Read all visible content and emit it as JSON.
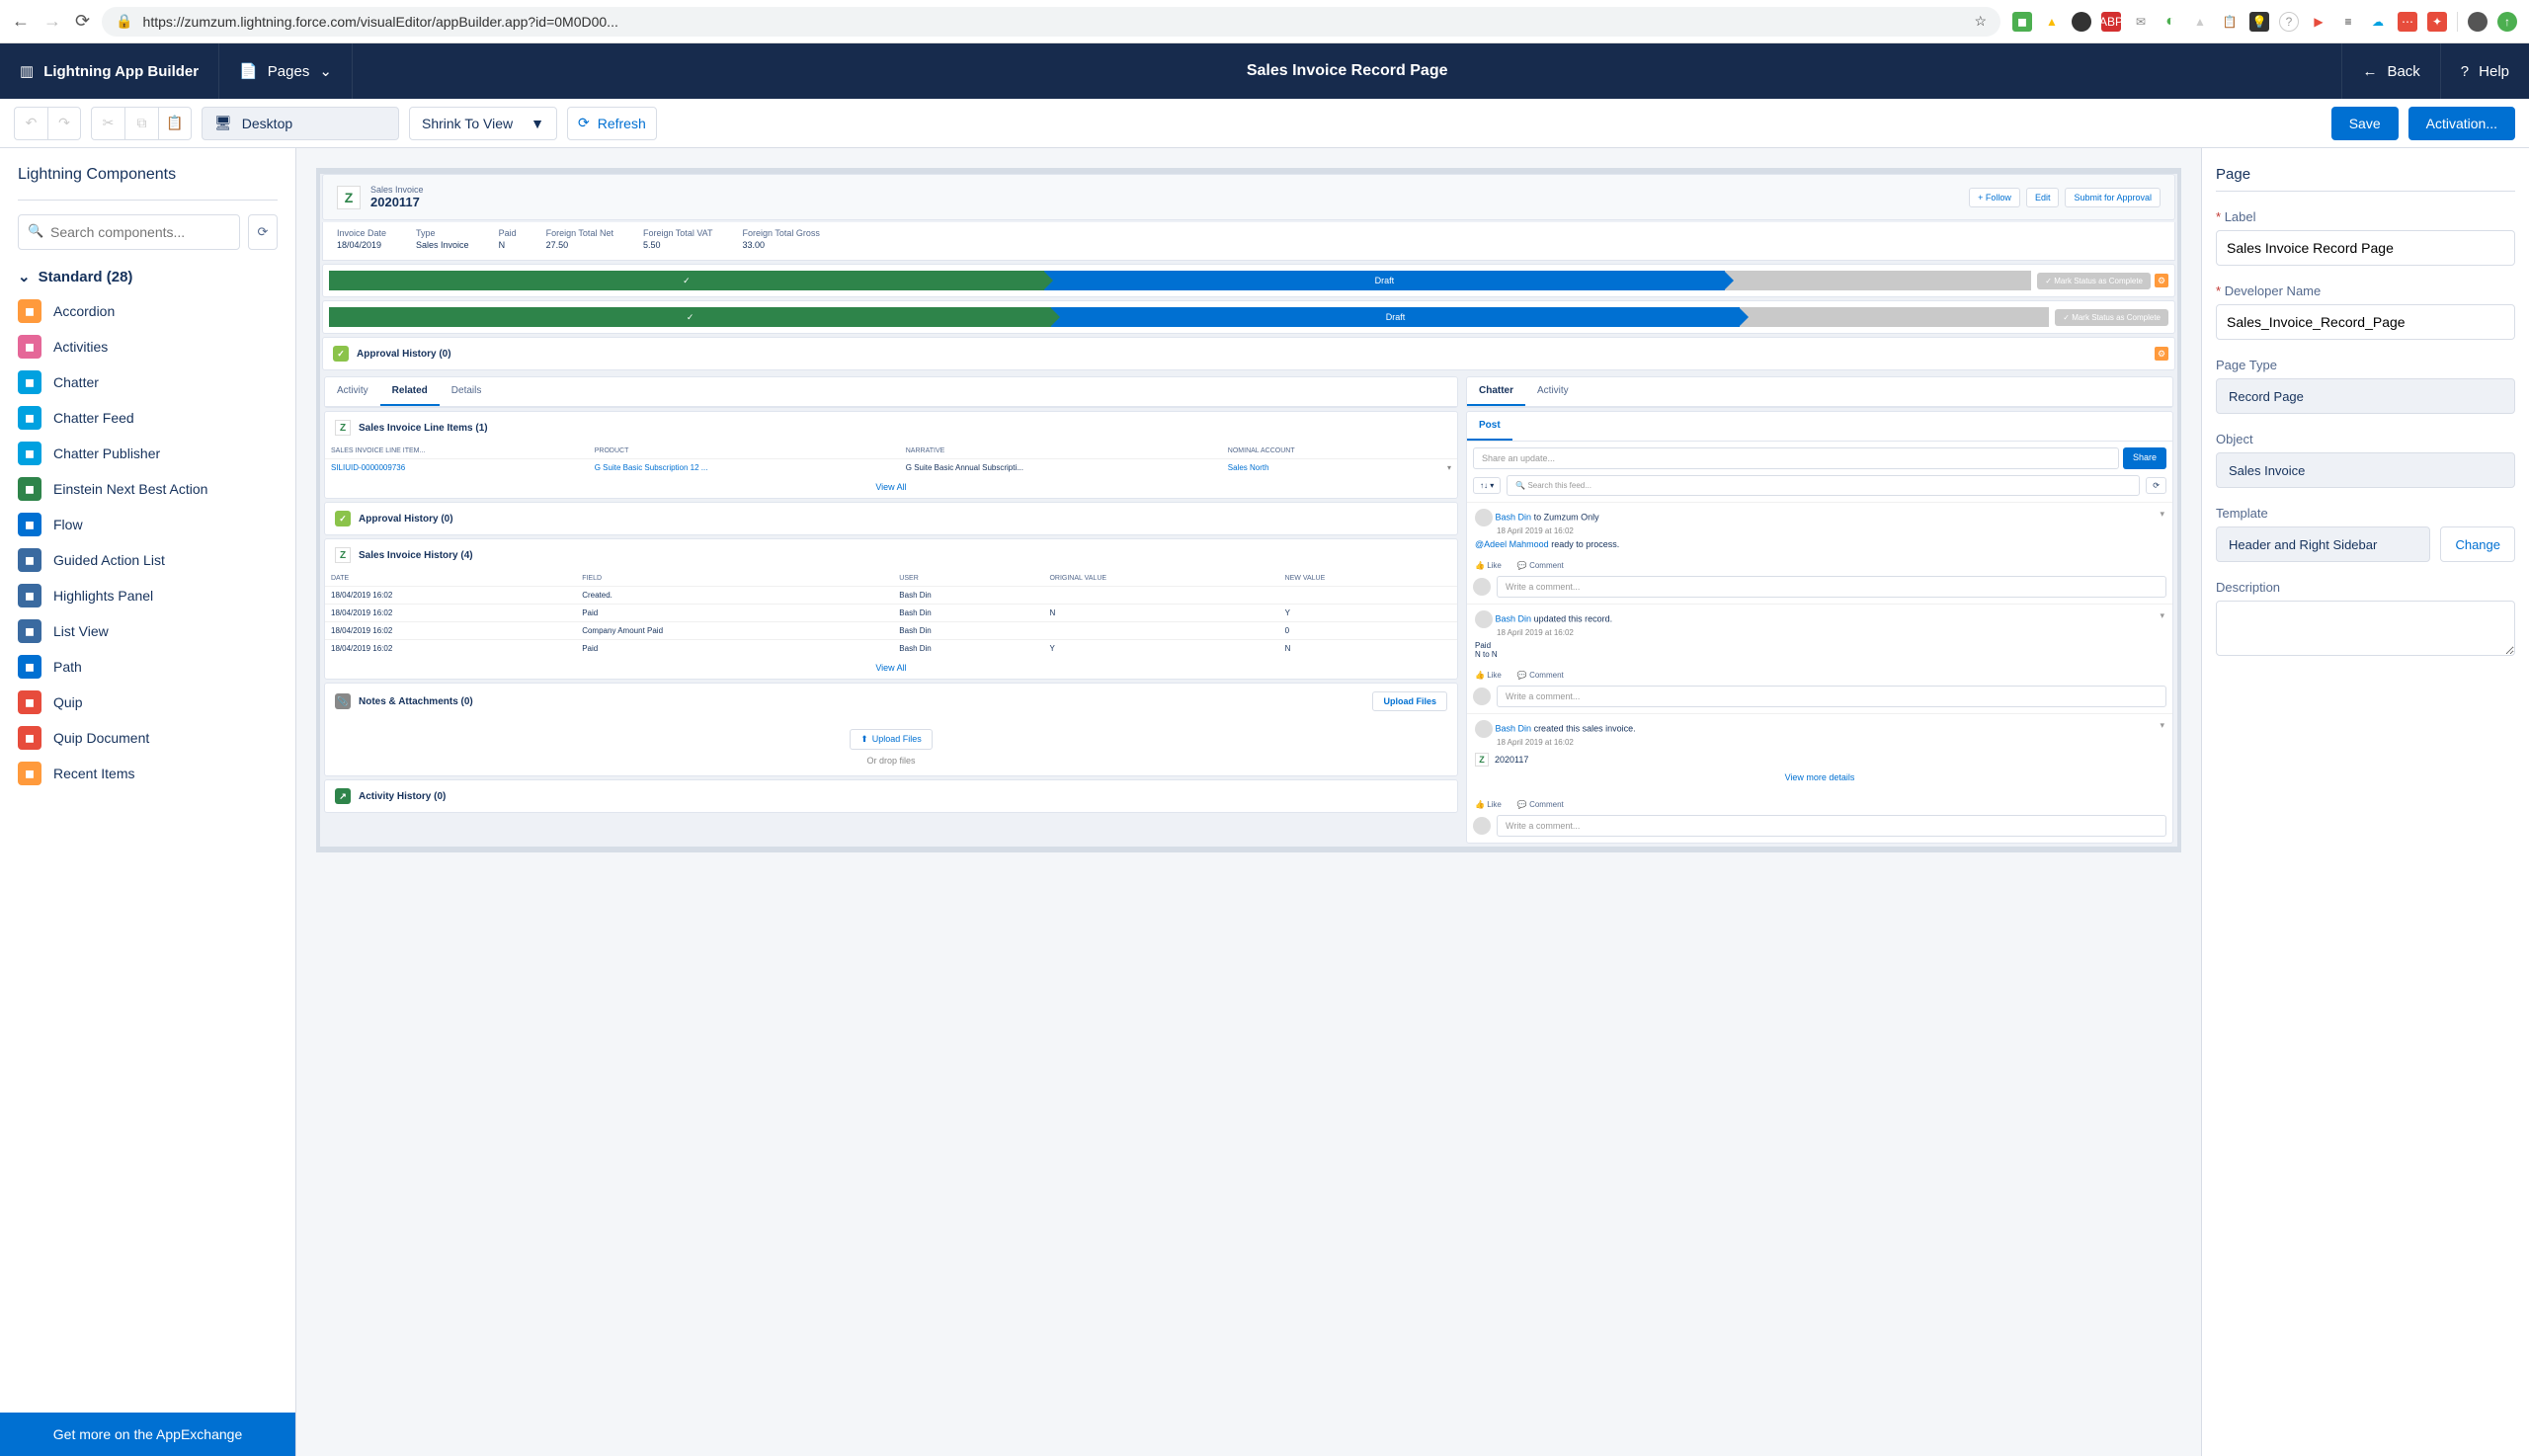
{
  "browser": {
    "url": "https://zumzum.lightning.force.com/visualEditor/appBuilder.app?id=0M0D00..."
  },
  "header": {
    "app_name": "Lightning App Builder",
    "pages_label": "Pages",
    "title": "Sales Invoice Record Page",
    "back": "Back",
    "help": "Help"
  },
  "toolbar": {
    "form_factor": "Desktop",
    "zoom": "Shrink To View",
    "refresh": "Refresh",
    "save": "Save",
    "activation": "Activation..."
  },
  "left": {
    "title": "Lightning Components",
    "search_placeholder": "Search components...",
    "category": "Standard (28)",
    "items": [
      {
        "label": "Accordion",
        "color": "#ff9a3c"
      },
      {
        "label": "Activities",
        "color": "#e56798"
      },
      {
        "label": "Chatter",
        "color": "#00a1e0"
      },
      {
        "label": "Chatter Feed",
        "color": "#00a1e0"
      },
      {
        "label": "Chatter Publisher",
        "color": "#00a1e0"
      },
      {
        "label": "Einstein Next Best Action",
        "color": "#2e844a"
      },
      {
        "label": "Flow",
        "color": "#0070d2"
      },
      {
        "label": "Guided Action List",
        "color": "#3a6aa0"
      },
      {
        "label": "Highlights Panel",
        "color": "#3a6aa0"
      },
      {
        "label": "List View",
        "color": "#3a6aa0"
      },
      {
        "label": "Path",
        "color": "#0070d2"
      },
      {
        "label": "Quip",
        "color": "#e74c3c"
      },
      {
        "label": "Quip Document",
        "color": "#e74c3c"
      },
      {
        "label": "Recent Items",
        "color": "#ff9a3c"
      }
    ],
    "footer": "Get more on the AppExchange"
  },
  "right": {
    "title": "Page",
    "label_label": "Label",
    "label_value": "Sales Invoice Record Page",
    "devname_label": "Developer Name",
    "devname_value": "Sales_Invoice_Record_Page",
    "pagetype_label": "Page Type",
    "pagetype_value": "Record Page",
    "object_label": "Object",
    "object_value": "Sales Invoice",
    "template_label": "Template",
    "template_value": "Header and Right Sidebar",
    "change": "Change",
    "description_label": "Description"
  },
  "preview": {
    "record_type": "Sales Invoice",
    "record_name": "2020117",
    "actions": {
      "follow": "Follow",
      "edit": "Edit",
      "submit": "Submit for Approval"
    },
    "fields": [
      {
        "l": "Invoice Date",
        "v": "18/04/2019"
      },
      {
        "l": "Type",
        "v": "Sales Invoice"
      },
      {
        "l": "Paid",
        "v": "N"
      },
      {
        "l": "Foreign Total Net",
        "v": "27.50"
      },
      {
        "l": "Foreign Total VAT",
        "v": "5.50"
      },
      {
        "l": "Foreign Total Gross",
        "v": "33.00"
      }
    ],
    "path": {
      "stage": "Draft",
      "mark": "Mark Status as Complete"
    },
    "approval_head": "Approval History (0)",
    "tabs_left": {
      "activity": "Activity",
      "related": "Related",
      "details": "Details"
    },
    "tabs_right": {
      "chatter": "Chatter",
      "activity": "Activity"
    },
    "lineitems": {
      "title": "Sales Invoice Line Items (1)",
      "cols": [
        "SALES INVOICE LINE ITEM...",
        "PRODUCT",
        "NARRATIVE",
        "NOMINAL ACCOUNT"
      ],
      "row": [
        "SILIUID-0000009736",
        "G Suite Basic Subscription 12 ...",
        "G Suite Basic Annual Subscripti...",
        "Sales North"
      ]
    },
    "view_all": "View All",
    "approval_title": "Approval History (0)",
    "history": {
      "title": "Sales Invoice History (4)",
      "cols": [
        "DATE",
        "FIELD",
        "USER",
        "ORIGINAL VALUE",
        "NEW VALUE"
      ],
      "rows": [
        [
          "18/04/2019 16:02",
          "Created.",
          "Bash Din",
          "",
          ""
        ],
        [
          "18/04/2019 16:02",
          "Paid",
          "Bash Din",
          "N",
          "Y"
        ],
        [
          "18/04/2019 16:02",
          "Company Amount Paid",
          "Bash Din",
          "",
          "0"
        ],
        [
          "18/04/2019 16:02",
          "Paid",
          "Bash Din",
          "Y",
          "N"
        ]
      ]
    },
    "notes": {
      "title": "Notes & Attachments (0)",
      "upload": "Upload Files",
      "drop": "Or drop files"
    },
    "activity_hist": "Activity History (0)",
    "chatter": {
      "post": "Post",
      "share_placeholder": "Share an update...",
      "share": "Share",
      "search": "Search this feed...",
      "feed1_author": "Bash Din",
      "feed1_to": "to Zumzum Only",
      "feed1_time": "18 April 2019 at 16:02",
      "feed1_mention": "@Adeel Mahmood",
      "feed1_text": "ready to process.",
      "like": "Like",
      "comment": "Comment",
      "write": "Write a comment...",
      "feed2_author": "Bash Din",
      "feed2_text": "updated this record.",
      "feed2_time": "18 April 2019 at 16:02",
      "feed2_field": "Paid",
      "feed2_change": "N to N",
      "feed3_author": "Bash Din",
      "feed3_text": "created this sales invoice.",
      "feed3_time": "18 April 2019 at 16:02",
      "feed3_rec": "2020117",
      "view_more": "View more details"
    }
  }
}
